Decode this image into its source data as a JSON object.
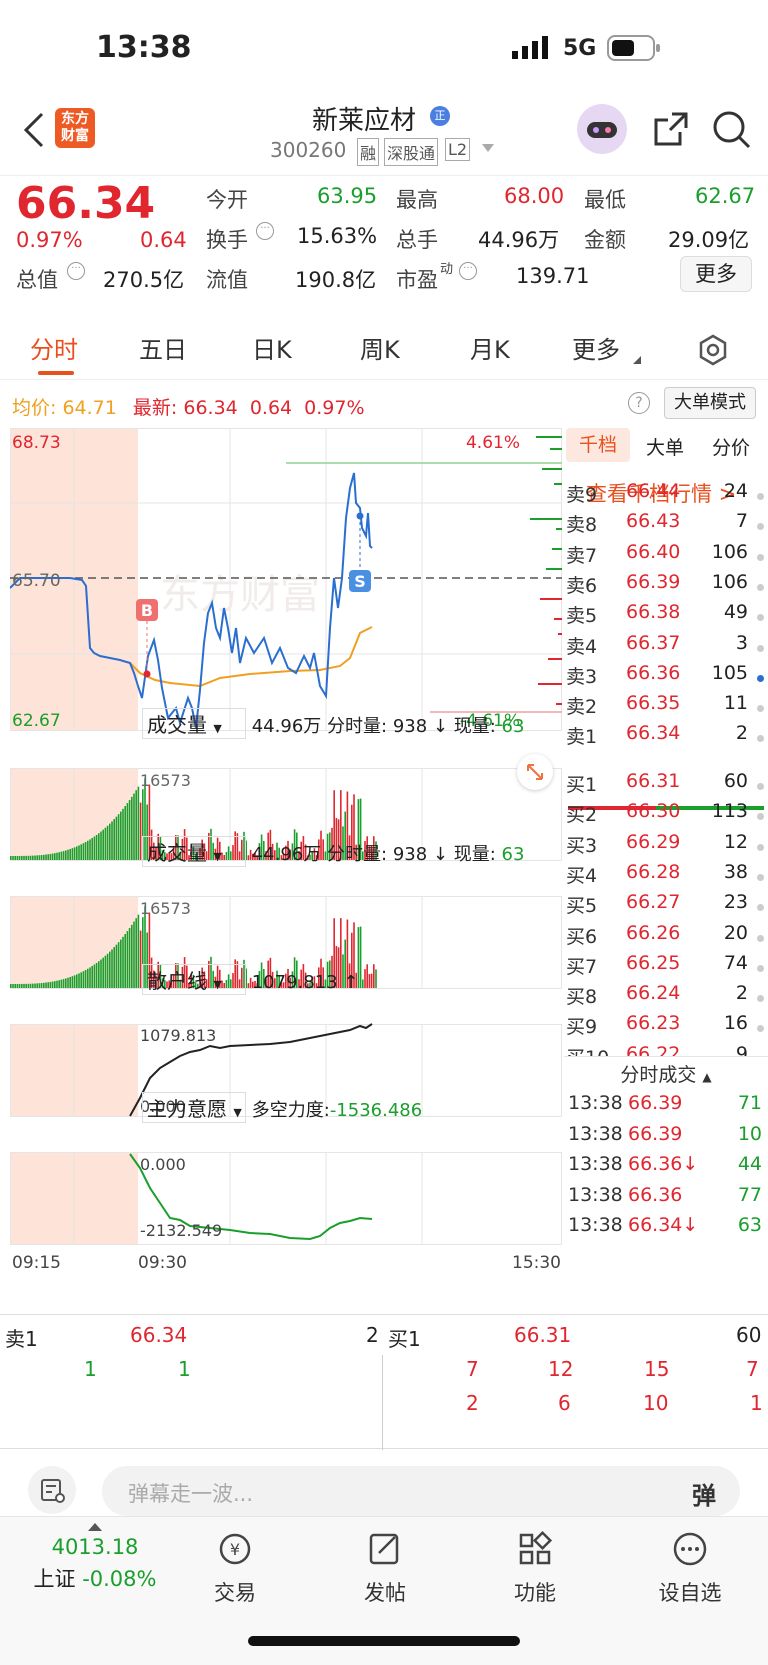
{
  "status": {
    "time": "13:38",
    "network": "5G"
  },
  "header": {
    "logo_line1": "东方",
    "logo_line2": "财富",
    "name": "新莱应材",
    "name_badge": "正",
    "code": "300260",
    "tag_margin": "融",
    "tag_connect": "深股通",
    "tag_level": "L2"
  },
  "quote": {
    "price": "66.34",
    "change_pct": "0.97%",
    "change": "0.64",
    "open_label": "今开",
    "open": "63.95",
    "high_label": "最高",
    "high": "68.00",
    "low_label": "最低",
    "low": "62.67",
    "turnover_label": "换手",
    "turnover": "15.63%",
    "volume_label": "总手",
    "volume": "44.96万",
    "amount_label": "金额",
    "amount": "29.09亿",
    "mktcap_label": "总值",
    "mktcap": "270.5亿",
    "float_label": "流值",
    "float": "190.8亿",
    "pe_label": "市盈",
    "pe_sup": "动",
    "pe": "139.71",
    "more_btn": "更多"
  },
  "tabs": [
    "分时",
    "五日",
    "日K",
    "周K",
    "月K",
    "更多"
  ],
  "chart": {
    "avg_label": "均价:",
    "avg": "64.71",
    "latest_label": "最新:",
    "latest": "66.34",
    "latest_chg": "0.64",
    "latest_pct": "0.97%",
    "big_order_btn": "大单模式",
    "y_top": "68.73",
    "y_mid": "65.70",
    "y_bottom": "62.67",
    "pct_top": "4.61%",
    "pct_bottom": "-4.61%",
    "marker_buy": "B",
    "marker_sell": "S",
    "watermark": "东方财富"
  },
  "volume_panel": {
    "label": "成交量",
    "total": "44.96万",
    "minute_label": "分时量:",
    "minute": "938",
    "now_label": "现量:",
    "now": "63",
    "max": "16573"
  },
  "retail_panel": {
    "label": "散户线",
    "value": "1079.813",
    "arrow": "↑",
    "top": "1079.813",
    "bottom": "0.000"
  },
  "main_panel": {
    "label": "主力意愿",
    "force_label": "多空力度:",
    "force": "-1536.486",
    "top": "0.000",
    "bottom": "-2132.549"
  },
  "time_axis": {
    "start": "09:15",
    "open": "09:30",
    "end": "15:30"
  },
  "orderbook": {
    "tabs": [
      "千档",
      "大单",
      "分价"
    ],
    "link": "查看千档行情 >",
    "asks": [
      {
        "label": "卖9",
        "price": "66.44",
        "vol": "24"
      },
      {
        "label": "卖8",
        "price": "66.43",
        "vol": "7"
      },
      {
        "label": "卖7",
        "price": "66.40",
        "vol": "106"
      },
      {
        "label": "卖6",
        "price": "66.39",
        "vol": "106"
      },
      {
        "label": "卖5",
        "price": "66.38",
        "vol": "49"
      },
      {
        "label": "卖4",
        "price": "66.37",
        "vol": "3"
      },
      {
        "label": "卖3",
        "price": "66.36",
        "vol": "105"
      },
      {
        "label": "卖2",
        "price": "66.35",
        "vol": "11"
      },
      {
        "label": "卖1",
        "price": "66.34",
        "vol": "2"
      }
    ],
    "bids": [
      {
        "label": "买1",
        "price": "66.31",
        "vol": "60"
      },
      {
        "label": "买2",
        "price": "66.30",
        "vol": "113"
      },
      {
        "label": "买3",
        "price": "66.29",
        "vol": "12"
      },
      {
        "label": "买4",
        "price": "66.28",
        "vol": "38"
      },
      {
        "label": "买5",
        "price": "66.27",
        "vol": "23"
      },
      {
        "label": "买6",
        "price": "66.26",
        "vol": "20"
      },
      {
        "label": "买7",
        "price": "66.25",
        "vol": "74"
      },
      {
        "label": "买8",
        "price": "66.24",
        "vol": "2"
      },
      {
        "label": "买9",
        "price": "66.23",
        "vol": "16"
      },
      {
        "label": "买10",
        "price": "66.22",
        "vol": "9"
      }
    ],
    "trades_title": "分时成交",
    "trades": [
      {
        "time": "13:38",
        "price": "66.39",
        "vol": "71"
      },
      {
        "time": "13:38",
        "price": "66.39",
        "vol": "10"
      },
      {
        "time": "13:38",
        "price": "66.36↓",
        "vol": "44"
      },
      {
        "time": "13:38",
        "price": "66.36",
        "vol": "77"
      },
      {
        "time": "13:38",
        "price": "66.34↓",
        "vol": "63"
      }
    ]
  },
  "bottom_quote": {
    "ask_label": "卖1",
    "ask_price": "66.34",
    "ask_vol": "2",
    "bid_label": "买1",
    "bid_price": "66.31",
    "bid_vol": "60",
    "ask_queue": [
      "1",
      "1"
    ],
    "bid_queue_row1": [
      "7",
      "12",
      "15",
      "7"
    ],
    "bid_queue_row2": [
      "2",
      "6",
      "10",
      "1"
    ]
  },
  "danmu": {
    "placeholder": "弹幕走一波...",
    "btn": "弹"
  },
  "footer": {
    "index_value": "4013.18",
    "index_name": "上证",
    "index_chg": "-0.08%",
    "items": [
      "交易",
      "发帖",
      "功能",
      "设自选"
    ]
  }
}
